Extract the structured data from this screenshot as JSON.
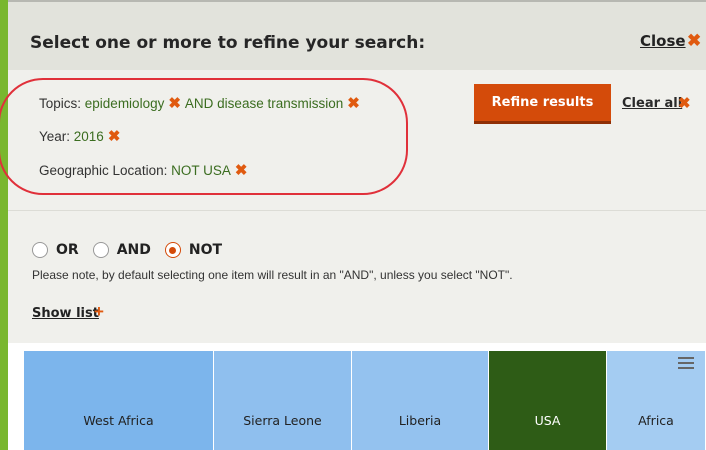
{
  "header": {
    "title": "Select one or more to refine your search:",
    "close_label": "Close",
    "close_icon": "✖"
  },
  "filters": {
    "topics": {
      "label": "Topics: ",
      "value1": "epidemiology",
      "value2": "AND disease transmission"
    },
    "year": {
      "label": "Year: ",
      "value": "2016"
    },
    "geo": {
      "label": "Geographic Location: ",
      "value": "NOT USA"
    },
    "remove_icon": "✖"
  },
  "actions": {
    "refine_label": "Refine results",
    "clear_label": "Clear all",
    "clear_icon": "✖"
  },
  "logic": {
    "options": [
      {
        "label": "OR"
      },
      {
        "label": "AND"
      },
      {
        "label": "NOT"
      }
    ],
    "selected": "NOT",
    "note": "Please note, by default selecting one item will result in an \"AND\", unless you select \"NOT\"."
  },
  "show_list": {
    "label": "Show list",
    "icon": "+"
  },
  "treemap": {
    "tiles": [
      {
        "label": "West Africa",
        "color": "#7cb5ec",
        "text_color": "#222222"
      },
      {
        "label": "Sierra Leone",
        "color": "#8fbfee",
        "text_color": "#222222"
      },
      {
        "label": "Liberia",
        "color": "#94c2ef",
        "text_color": "#222222"
      },
      {
        "label": "USA",
        "color": "#2e5c16",
        "text_color": "#ffffff"
      },
      {
        "label": "Africa",
        "color": "#a4ccf2",
        "text_color": "#222222"
      }
    ]
  },
  "colors": {
    "accent": "#d44b0a",
    "green_bar": "#79b72f",
    "value_text": "#3b6d20",
    "highlight": "#e0303a"
  }
}
